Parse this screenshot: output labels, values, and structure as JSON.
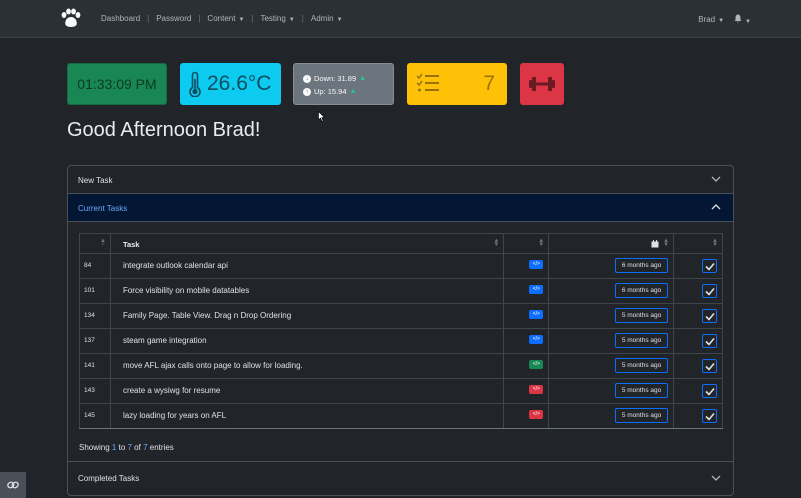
{
  "nav": {
    "items": [
      {
        "label": "Dashboard",
        "dropdown": false
      },
      {
        "label": "Password",
        "dropdown": false
      },
      {
        "label": "Content",
        "dropdown": true
      },
      {
        "label": "Testing",
        "dropdown": true
      },
      {
        "label": "Admin",
        "dropdown": true
      }
    ],
    "user": "Brad"
  },
  "widgets": {
    "clock": "01:33:09 PM",
    "temperature": "26.6°C",
    "download": "Down: 31.89",
    "upload": "Up: 15.94",
    "task_count": "7"
  },
  "greeting": "Good Afternoon Brad!",
  "accordion": {
    "new_task": "New Task",
    "current_tasks": "Current Tasks",
    "completed_tasks": "Completed Tasks"
  },
  "table": {
    "headers": {
      "task": "Task"
    },
    "rows": [
      {
        "id": "84",
        "task": "integrate outlook calendar api",
        "badge": "blue",
        "badge_icon": "</>",
        "date": "6 months ago"
      },
      {
        "id": "101",
        "task": "Force visibility on mobile datatables",
        "badge": "blue",
        "badge_icon": "</>",
        "date": "6 months ago"
      },
      {
        "id": "134",
        "task": "Family Page. Table View. Drag n Drop Ordering",
        "badge": "blue",
        "badge_icon": "</>",
        "date": "5 months ago"
      },
      {
        "id": "137",
        "task": "steam game integration",
        "badge": "blue",
        "badge_icon": "</>",
        "date": "5 months ago"
      },
      {
        "id": "141",
        "task": "move AFL ajax calls onto page to allow for loading.",
        "badge": "green",
        "badge_icon": "</>",
        "date": "5 months ago"
      },
      {
        "id": "143",
        "task": "create a wysiwg for resume",
        "badge": "red",
        "badge_icon": "</>",
        "date": "5 months ago"
      },
      {
        "id": "145",
        "task": "lazy loading for years on AFL",
        "badge": "red",
        "badge_icon": "</>",
        "date": "5 months ago"
      }
    ],
    "info": {
      "prefix": "Showing ",
      "from": "1",
      "mid1": " to ",
      "to": "7",
      "mid2": " of ",
      "total": "7",
      "suffix": " entries"
    }
  },
  "colors": {
    "primary": "#0d6efd",
    "success": "#198754",
    "info": "#0dcaf0",
    "warning": "#ffc107",
    "danger": "#dc3545",
    "secondary": "#6c757d"
  }
}
